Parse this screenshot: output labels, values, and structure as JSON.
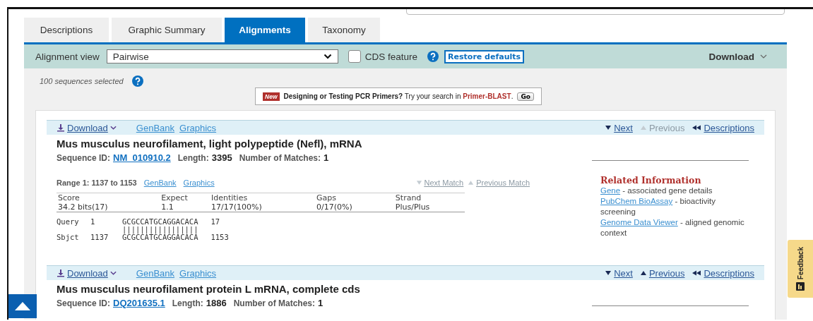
{
  "tabs": [
    {
      "label": "Descriptions",
      "selected": false
    },
    {
      "label": "Graphic Summary",
      "selected": false
    },
    {
      "label": "Alignments",
      "selected": true
    },
    {
      "label": "Taxonomy",
      "selected": false
    }
  ],
  "toolbar": {
    "view_label": "Alignment view",
    "view_value": "Pairwise",
    "cds_label": "CDS feature",
    "cds_checked": false,
    "restore": "Restore defaults",
    "download": "Download"
  },
  "selection": "100 sequences selected",
  "promo": {
    "badge": "New",
    "text": "**Designing or Testing PCR Primers?** Try your search in **Primer-BLAST**.",
    "go": "Go"
  },
  "hits": [
    {
      "download": "Download",
      "genbank": "GenBank",
      "graphics": "Graphics",
      "next": {
        "label": "Next",
        "disabled": false
      },
      "previous": {
        "label": "Previous",
        "disabled": true
      },
      "descriptions": "Descriptions",
      "title": "Mus musculus neurofilament, light polypeptide (Nefl), mRNA",
      "seq_label": "Sequence ID:",
      "seq_id": "NM_010910.2",
      "length_label": "Length:",
      "length": "3395",
      "matches_label": "Number of Matches:",
      "matches": "1",
      "range": {
        "label": "Range 1: 1137 to 1153",
        "genbank": "GenBank",
        "graphics": "Graphics",
        "next_match": "Next Match",
        "previous_match": "Previous Match"
      },
      "stats": [
        {
          "name": "Score",
          "value": "34.2 bits(17)"
        },
        {
          "name": "Expect",
          "value": "1.1"
        },
        {
          "name": "Identities",
          "value": "17/17(100%)"
        },
        {
          "name": "Gaps",
          "value": "0/17(0%)"
        },
        {
          "name": "Strand",
          "value": "Plus/Plus"
        }
      ],
      "alignment": {
        "query": {
          "label": "Query",
          "start": "1",
          "seq": "GCGCCATGCAGGACACA",
          "end": "17"
        },
        "match": "|||||||||||||||||",
        "sbjct": {
          "label": "Sbjct",
          "start": "1137",
          "seq": "GCGCCATGCAGGACACA",
          "end": "1153"
        }
      },
      "related": {
        "title": "Related Information",
        "links": [
          {
            "link": "Gene",
            "text": "- associated gene details"
          },
          {
            "link": "PubChem BioAssay",
            "text": "- bioactivity screening"
          },
          {
            "link": "Genome Data Viewer",
            "text": "- aligned genomic context"
          }
        ]
      }
    },
    {
      "download": "Download",
      "genbank": "GenBank",
      "graphics": "Graphics",
      "next": {
        "label": "Next",
        "disabled": false
      },
      "previous": {
        "label": "Previous",
        "disabled": false
      },
      "descriptions": "Descriptions",
      "title": "Mus musculus neurofilament protein L mRNA, complete cds",
      "seq_label": "Sequence ID:",
      "seq_id": "DQ201635.1",
      "length_label": "Length:",
      "length": "1886",
      "matches_label": "Number of Matches:",
      "matches": "1"
    }
  ],
  "feedback": "Feedback"
}
